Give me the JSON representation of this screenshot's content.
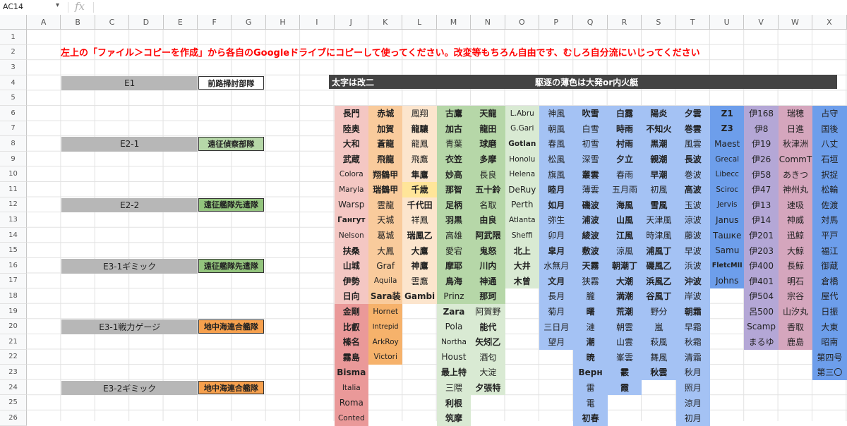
{
  "toolbar": {
    "name_box": "AC14",
    "fx_label": "fx"
  },
  "columns": [
    "A",
    "B",
    "C",
    "D",
    "E",
    "F",
    "G",
    "H",
    "I",
    "J",
    "K",
    "L",
    "M",
    "N",
    "O",
    "P",
    "Q",
    "R",
    "S",
    "T",
    "U",
    "V",
    "W",
    "X"
  ],
  "rows": [
    "1",
    "2",
    "3",
    "4",
    "5",
    "6",
    "7",
    "8",
    "9",
    "10",
    "11",
    "12",
    "13",
    "14",
    "15",
    "16",
    "17",
    "18",
    "19",
    "20",
    "21",
    "22",
    "23",
    "24",
    "25",
    "26"
  ],
  "notice": "左上の「ファイル＞コピーを作成」から各自のGoogleドライブにコピーして使ってください。改変等もちろん自由です、むしろ自分流にいじってください",
  "operations": [
    {
      "label": "E1",
      "tag": "前路掃討部隊",
      "tag_color": "#ffffff"
    },
    {
      "label": "E2-1",
      "tag": "遠征偵察部隊",
      "tag_color": "#b6d7a8"
    },
    {
      "label": "E2-2",
      "tag": "遠征艦隊先遣隊",
      "tag_color": "#93c47d"
    },
    {
      "label": "E3-1ギミック",
      "tag": "遠征艦隊先遣隊",
      "tag_color": "#93c47d"
    },
    {
      "label": "E3-1戦力ゲージ",
      "tag": "地中海連合艦隊",
      "tag_color": "#f6a04d"
    },
    {
      "label": "E3-2ギミック",
      "tag": "地中海連合艦隊",
      "tag_color": "#f6a04d"
    }
  ],
  "legend": {
    "left": "太字は改二",
    "right": "駆逐の薄色は大発or内火艇"
  },
  "ship_columns": [
    {
      "col": "J",
      "color": "#f4c7c3",
      "dark": "#ea9999",
      "cells": [
        {
          "t": "長門",
          "b": true
        },
        {
          "t": "陸奥",
          "b": true
        },
        {
          "t": "大和",
          "b": true
        },
        {
          "t": "武蔵",
          "b": true
        },
        {
          "t": "Colora"
        },
        {
          "t": "Maryla"
        },
        {
          "t": "Warsp"
        },
        {
          "t": "Гангут",
          "b": true
        },
        {
          "t": "Nelson"
        },
        {
          "t": "扶桑",
          "b": true
        },
        {
          "t": "山城",
          "b": true
        },
        {
          "t": "伊勢",
          "b": true
        },
        {
          "t": "日向",
          "b": true
        },
        {
          "t": "金剛",
          "b": true,
          "d": true
        },
        {
          "t": "比叡",
          "b": true,
          "d": true
        },
        {
          "t": "榛名",
          "b": true,
          "d": true
        },
        {
          "t": "霧島",
          "b": true,
          "d": true
        },
        {
          "t": "Bisma",
          "b": true,
          "d": true
        },
        {
          "t": "Italia",
          "d": true
        },
        {
          "t": "Roma",
          "d": true
        },
        {
          "t": "Conted",
          "d": true
        }
      ]
    },
    {
      "col": "K",
      "color": "#f9cb9c",
      "dark": "#f6b26b",
      "cells": [
        {
          "t": "赤城",
          "b": true
        },
        {
          "t": "加賀",
          "b": true
        },
        {
          "t": "蒼龍",
          "b": true
        },
        {
          "t": "飛龍",
          "b": true
        },
        {
          "t": "翔鶴甲",
          "b": true
        },
        {
          "t": "瑞鶴甲",
          "b": true
        },
        {
          "t": "雲龍"
        },
        {
          "t": "天城"
        },
        {
          "t": "葛城"
        },
        {
          "t": "大鳳"
        },
        {
          "t": "Graf"
        },
        {
          "t": "Aquila"
        },
        {
          "t": "Sara装",
          "b": true
        },
        {
          "t": "Hornet",
          "d": true
        },
        {
          "t": "Intrepid",
          "d": true
        },
        {
          "t": "ArkRoy",
          "d": true
        },
        {
          "t": "Victori",
          "d": true
        }
      ]
    },
    {
      "col": "L",
      "color": "#fce5cd",
      "dark": "#ffe599",
      "cells": [
        {
          "t": "鳳翔"
        },
        {
          "t": "龍驤",
          "b": true
        },
        {
          "t": "龍鳳"
        },
        {
          "t": "飛鷹"
        },
        {
          "t": "隼鷹",
          "b": true
        },
        {
          "t": "千歳",
          "b": true,
          "d": true
        },
        {
          "t": "千代田",
          "b": true
        },
        {
          "t": "祥鳳"
        },
        {
          "t": "瑞鳳乙",
          "b": true
        },
        {
          "t": "大鷹",
          "b": true
        },
        {
          "t": "神鷹",
          "b": true
        },
        {
          "t": "雲鷹"
        },
        {
          "t": "Gambi",
          "b": true
        }
      ]
    },
    {
      "col": "M",
      "color": "#b6d7a8",
      "dark": "#d9ead3",
      "cells": [
        {
          "t": "古鷹",
          "b": true
        },
        {
          "t": "加古",
          "b": true
        },
        {
          "t": "青葉"
        },
        {
          "t": "衣笠",
          "b": true
        },
        {
          "t": "妙高",
          "b": true
        },
        {
          "t": "那智",
          "b": true
        },
        {
          "t": "足柄",
          "b": true
        },
        {
          "t": "羽黒",
          "b": true
        },
        {
          "t": "高雄"
        },
        {
          "t": "愛宕"
        },
        {
          "t": "摩耶",
          "b": true
        },
        {
          "t": "鳥海",
          "b": true
        },
        {
          "t": "Prinz"
        },
        {
          "t": "Zara",
          "b": true,
          "d": true
        },
        {
          "t": "Pola",
          "d": true
        },
        {
          "t": "Northa",
          "d": true
        },
        {
          "t": "Houst",
          "d": true
        },
        {
          "t": "最上特",
          "b": true,
          "d": true
        },
        {
          "t": "三隈",
          "d": true
        },
        {
          "t": "利根",
          "b": true,
          "d": true
        },
        {
          "t": "筑摩",
          "b": true,
          "d": true
        }
      ]
    },
    {
      "col": "N",
      "color": "#b6d7a8",
      "dark": "#d9ead3",
      "cells": [
        {
          "t": "天龍",
          "b": true
        },
        {
          "t": "龍田",
          "b": true
        },
        {
          "t": "球磨",
          "b": true
        },
        {
          "t": "多摩",
          "b": true
        },
        {
          "t": "長良"
        },
        {
          "t": "五十鈴",
          "b": true
        },
        {
          "t": "名取"
        },
        {
          "t": "由良",
          "b": true
        },
        {
          "t": "阿武隈",
          "b": true
        },
        {
          "t": "鬼怒",
          "b": true
        },
        {
          "t": "川内",
          "b": true
        },
        {
          "t": "神通",
          "b": true
        },
        {
          "t": "那珂",
          "b": true
        },
        {
          "t": "阿賀野",
          "d": true
        },
        {
          "t": "能代",
          "b": true,
          "d": true
        },
        {
          "t": "矢矧乙",
          "b": true,
          "d": true
        },
        {
          "t": "酒匂",
          "d": true
        },
        {
          "t": "大淀",
          "d": true
        },
        {
          "t": "夕張特",
          "b": true,
          "d": true
        }
      ]
    },
    {
      "col": "O",
      "color": "#d9ead3",
      "dark": "#d9ead3",
      "cells": [
        {
          "t": "L.Abru"
        },
        {
          "t": "G.Gari"
        },
        {
          "t": "Gotlan",
          "b": true
        },
        {
          "t": "Honolu"
        },
        {
          "t": "Helena"
        },
        {
          "t": "DeRuy"
        },
        {
          "t": "Perth"
        },
        {
          "t": "Atlanta"
        },
        {
          "t": "Sheffi"
        },
        {
          "t": "北上",
          "b": true
        },
        {
          "t": "大井",
          "b": true
        },
        {
          "t": "木曾",
          "b": true
        }
      ]
    },
    {
      "col": "P",
      "color": "#a4c2f4",
      "dark": "#a4c2f4",
      "cells": [
        {
          "t": "神風"
        },
        {
          "t": "朝風"
        },
        {
          "t": "春風"
        },
        {
          "t": "松風"
        },
        {
          "t": "旗風"
        },
        {
          "t": "睦月",
          "b": true
        },
        {
          "t": "如月",
          "b": true
        },
        {
          "t": "弥生"
        },
        {
          "t": "卯月"
        },
        {
          "t": "皐月",
          "b": true
        },
        {
          "t": "水無月"
        },
        {
          "t": "文月",
          "b": true
        },
        {
          "t": "長月"
        },
        {
          "t": "菊月"
        },
        {
          "t": "三日月"
        },
        {
          "t": "望月"
        }
      ]
    },
    {
      "col": "Q",
      "color": "#a4c2f4",
      "dark": "#c9daf8",
      "cells": [
        {
          "t": "吹雪",
          "b": true
        },
        {
          "t": "白雪"
        },
        {
          "t": "初雪"
        },
        {
          "t": "深雪"
        },
        {
          "t": "叢雲",
          "b": true
        },
        {
          "t": "薄雲"
        },
        {
          "t": "磯波",
          "b": true
        },
        {
          "t": "浦波",
          "b": true
        },
        {
          "t": "綾波",
          "b": true
        },
        {
          "t": "敷波",
          "b": true
        },
        {
          "t": "天霧",
          "b": true
        },
        {
          "t": "狭霧"
        },
        {
          "t": "朧"
        },
        {
          "t": "曙",
          "b": true
        },
        {
          "t": "漣"
        },
        {
          "t": "潮",
          "b": true
        },
        {
          "t": "暁",
          "b": true
        },
        {
          "t": "Верн",
          "b": true
        },
        {
          "t": "雷"
        },
        {
          "t": "電"
        },
        {
          "t": "初春",
          "b": true
        }
      ]
    },
    {
      "col": "R",
      "color": "#a4c2f4",
      "dark": "#c9daf8",
      "cells": [
        {
          "t": "白露",
          "b": true
        },
        {
          "t": "時雨",
          "b": true
        },
        {
          "t": "村雨",
          "b": true
        },
        {
          "t": "夕立",
          "b": true
        },
        {
          "t": "春雨"
        },
        {
          "t": "五月雨"
        },
        {
          "t": "海風",
          "b": true
        },
        {
          "t": "山風",
          "b": true
        },
        {
          "t": "江風",
          "b": true
        },
        {
          "t": "涼風"
        },
        {
          "t": "朝潮丁",
          "b": true
        },
        {
          "t": "大潮",
          "b": true
        },
        {
          "t": "満潮",
          "b": true
        },
        {
          "t": "荒潮",
          "b": true
        },
        {
          "t": "朝雲"
        },
        {
          "t": "山雲"
        },
        {
          "t": "峯雲"
        },
        {
          "t": "霰",
          "b": true
        },
        {
          "t": "霞",
          "b": true
        }
      ]
    },
    {
      "col": "S",
      "color": "#a4c2f4",
      "dark": "#c9daf8",
      "cells": [
        {
          "t": "陽炎",
          "b": true
        },
        {
          "t": "不知火",
          "b": true
        },
        {
          "t": "黒潮",
          "b": true
        },
        {
          "t": "親潮",
          "b": true
        },
        {
          "t": "早潮",
          "b": true
        },
        {
          "t": "初風"
        },
        {
          "t": "雪風",
          "b": true
        },
        {
          "t": "天津風"
        },
        {
          "t": "時津風"
        },
        {
          "t": "浦風丁",
          "b": true
        },
        {
          "t": "磯風乙",
          "b": true
        },
        {
          "t": "浜風乙",
          "b": true
        },
        {
          "t": "谷風丁",
          "b": true
        },
        {
          "t": "野分"
        },
        {
          "t": "嵐"
        },
        {
          "t": "萩風"
        },
        {
          "t": "舞風"
        },
        {
          "t": "秋雲",
          "b": true
        }
      ]
    },
    {
      "col": "T",
      "color": "#a4c2f4",
      "dark": "#c9daf8",
      "cells": [
        {
          "t": "夕雲",
          "b": true
        },
        {
          "t": "巻雲",
          "b": true
        },
        {
          "t": "風雲"
        },
        {
          "t": "長波",
          "b": true
        },
        {
          "t": "巻波"
        },
        {
          "t": "高波",
          "b": true
        },
        {
          "t": "玉波"
        },
        {
          "t": "涼波"
        },
        {
          "t": "藤波"
        },
        {
          "t": "早波"
        },
        {
          "t": "浜波"
        },
        {
          "t": "沖波",
          "b": true
        },
        {
          "t": "岸波"
        },
        {
          "t": "朝霜",
          "b": true
        },
        {
          "t": "早霜"
        },
        {
          "t": "秋霜"
        },
        {
          "t": "清霜"
        },
        {
          "t": "秋月"
        },
        {
          "t": "照月"
        },
        {
          "t": "涼月"
        },
        {
          "t": "初月"
        }
      ]
    },
    {
      "col": "U",
      "color": "#6d9eeb",
      "dark": "#6d9eeb",
      "cells": [
        {
          "t": "Z1",
          "b": true
        },
        {
          "t": "Z3",
          "b": true
        },
        {
          "t": "Maest"
        },
        {
          "t": "Grecal"
        },
        {
          "t": "Libecc"
        },
        {
          "t": "Sciroc"
        },
        {
          "t": "Jervis"
        },
        {
          "t": "Janus"
        },
        {
          "t": "Ташке"
        },
        {
          "t": "Samu"
        },
        {
          "t": "FletcMII",
          "b": true
        },
        {
          "t": "Johns"
        }
      ]
    },
    {
      "col": "V",
      "color": "#b4a7d6",
      "dark": "#b4a7d6",
      "cells": [
        {
          "t": "伊168"
        },
        {
          "t": "伊8"
        },
        {
          "t": "伊19"
        },
        {
          "t": "伊26"
        },
        {
          "t": "伊58"
        },
        {
          "t": "伊47"
        },
        {
          "t": "伊13"
        },
        {
          "t": "伊14"
        },
        {
          "t": "伊201"
        },
        {
          "t": "伊203"
        },
        {
          "t": "伊400"
        },
        {
          "t": "伊401"
        },
        {
          "t": "伊504"
        },
        {
          "t": "呂500"
        },
        {
          "t": "Scamp"
        },
        {
          "t": "まるゆ"
        }
      ]
    },
    {
      "col": "W",
      "color": "#d5a6bd",
      "dark": "#d5a6bd",
      "cells": [
        {
          "t": "瑞穂"
        },
        {
          "t": "日進"
        },
        {
          "t": "秋津洲"
        },
        {
          "t": "CommT"
        },
        {
          "t": "あきつ"
        },
        {
          "t": "神州丸"
        },
        {
          "t": "速吸"
        },
        {
          "t": "神威"
        },
        {
          "t": "迅鯨"
        },
        {
          "t": "大鯨"
        },
        {
          "t": "長鯨"
        },
        {
          "t": "明石"
        },
        {
          "t": "宗谷"
        },
        {
          "t": "山汐丸"
        },
        {
          "t": "香取"
        },
        {
          "t": "鹿島"
        }
      ]
    },
    {
      "col": "X",
      "color": "#6d9eeb",
      "dark": "#6d9eeb",
      "cells": [
        {
          "t": "占守"
        },
        {
          "t": "国後"
        },
        {
          "t": "八丈"
        },
        {
          "t": "石垣"
        },
        {
          "t": "択捉"
        },
        {
          "t": "松輪"
        },
        {
          "t": "佐渡"
        },
        {
          "t": "対馬"
        },
        {
          "t": "平戸"
        },
        {
          "t": "福江"
        },
        {
          "t": "御蔵"
        },
        {
          "t": "倉橋"
        },
        {
          "t": "屋代"
        },
        {
          "t": "日振"
        },
        {
          "t": "大東"
        },
        {
          "t": "昭南"
        },
        {
          "t": "第四号"
        },
        {
          "t": "第三〇"
        }
      ]
    }
  ]
}
